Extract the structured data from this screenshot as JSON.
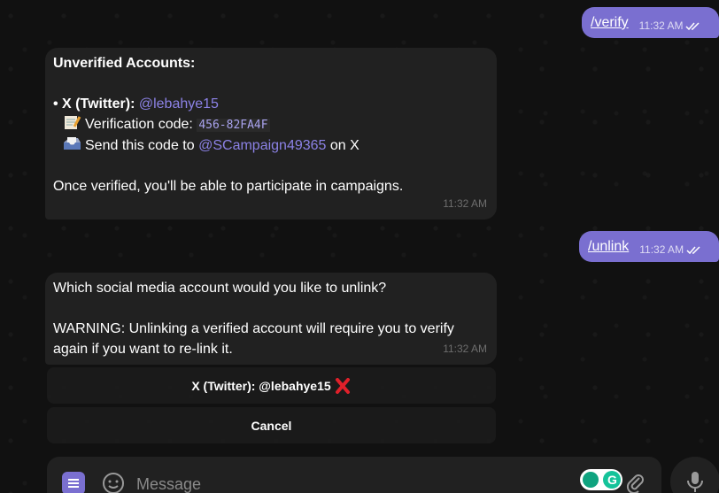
{
  "messages": {
    "verify_cmd": {
      "text": "/verify",
      "time": "11:32 AM"
    },
    "unverified": {
      "heading": "Unverified Accounts:",
      "bullet": "• ",
      "platform": "X (Twitter):",
      "handle": "@lebahye15",
      "code_label": "Verification code:",
      "code": "456-82FA4F",
      "send_prefix": "Send this code to",
      "send_handle": "@SCampaign49365",
      "send_suffix": "on X",
      "footer": "Once verified, you'll be able to participate in campaigns.",
      "time": "11:32 AM"
    },
    "unlink_cmd": {
      "text": "/unlink",
      "time": "11:32 AM"
    },
    "unlink_prompt": {
      "question": "Which social media account would you like to unlink?",
      "warning_line1": "WARNING: Unlinking a verified account will require you to verify",
      "warning_line2": "again if you want to re-link it.",
      "time": "11:32 AM"
    }
  },
  "keyboard": {
    "account_button": "X (Twitter): @lebahye15",
    "cancel_button": "Cancel"
  },
  "composer": {
    "placeholder": "Message"
  },
  "icons": {
    "read_receipt": "double-check-icon",
    "memo": "memo-emoji-icon",
    "outbox": "outbox-emoji-icon",
    "remove": "red-cross-icon",
    "menu": "bot-menu-icon",
    "emoji": "emoji-icon",
    "attach": "paperclip-icon",
    "mic": "microphone-icon",
    "grammarly": "grammarly-icon"
  },
  "colors": {
    "outgoing_bubble": "#7a6fd0",
    "incoming_bubble": "#212121",
    "link": "#8c82e6",
    "background": "#111111"
  }
}
